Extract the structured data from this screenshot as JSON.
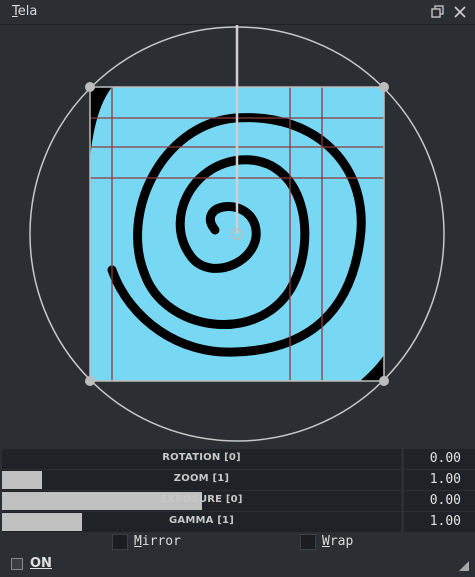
{
  "window": {
    "title_first_letter": "T",
    "title_rest": "ela",
    "restore_icon": "restore-window-icon",
    "close_icon": "close-icon"
  },
  "colors": {
    "canvas_fill": "#78d8f4",
    "guide_line": "#8b3a3f",
    "handle": "#bdbdbd"
  },
  "params": [
    {
      "label": "ROTATION [0]",
      "value": "0.00",
      "fill_fraction": 0.0
    },
    {
      "label": "ZOOM [1]",
      "value": "1.00",
      "fill_fraction": 0.1
    },
    {
      "label": "EXPOSURE [0]",
      "value": "0.00",
      "fill_fraction": 0.5
    },
    {
      "label": "GAMMA [1]",
      "value": "1.00",
      "fill_fraction": 0.2
    }
  ],
  "checks": {
    "mirror_first": "M",
    "mirror_rest": "irror",
    "wrap_first": "W",
    "wrap_rest": "rap"
  },
  "on": {
    "label": "ON"
  }
}
